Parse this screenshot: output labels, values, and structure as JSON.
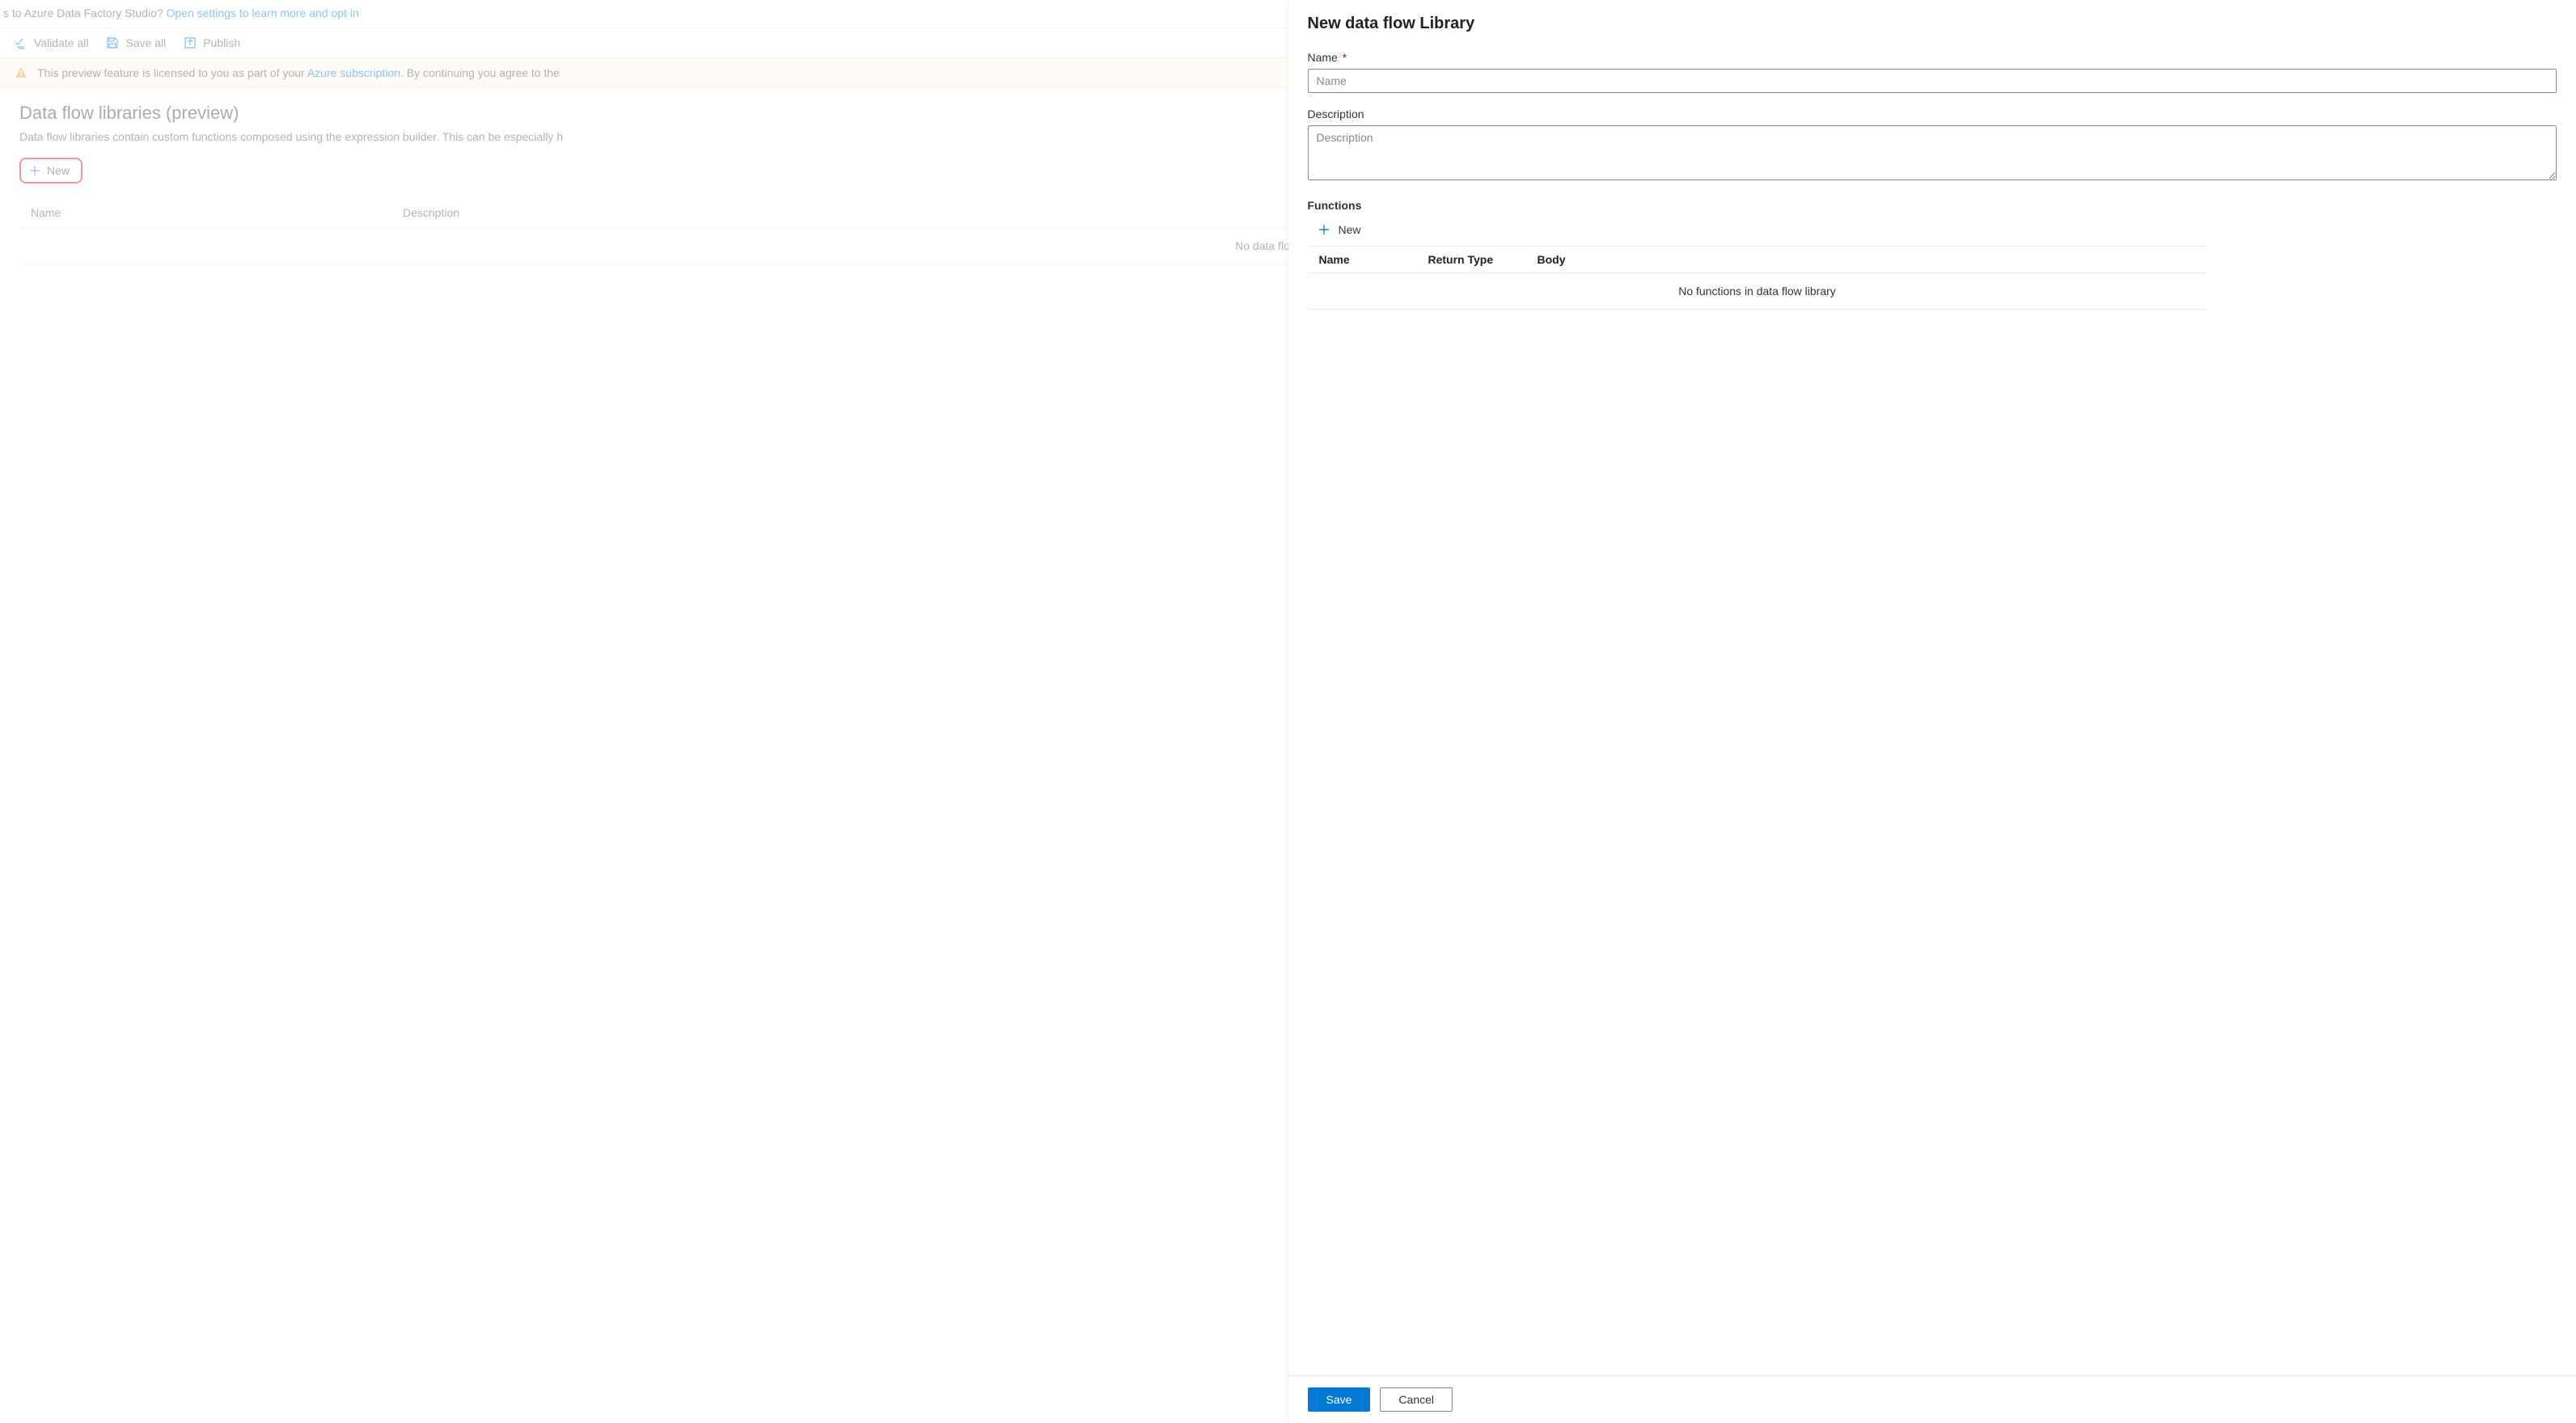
{
  "top_banner": {
    "prefix": "s to Azure Data Factory Studio? ",
    "link": "Open settings to learn more and opt in"
  },
  "toolbar": {
    "validate_all": "Validate all",
    "save_all": "Save all",
    "publish": "Publish"
  },
  "info_bar": {
    "text_before": "This preview feature is licensed to you as part of your ",
    "link": "Azure subscription.",
    "text_after": " By continuing you agree to the"
  },
  "page": {
    "title": "Data flow libraries (preview)",
    "subtitle": "Data flow libraries contain custom functions composed using the expression builder. This can be especially h",
    "new_button": "New",
    "table": {
      "col_name": "Name",
      "col_description": "Description",
      "empty": "No data flow libraries "
    }
  },
  "panel": {
    "title": "New data flow Library",
    "name_label": "Name",
    "name_required": "*",
    "name_placeholder": "Name",
    "description_label": "Description",
    "description_placeholder": "Description",
    "functions_label": "Functions",
    "functions_new": "New",
    "functions_table": {
      "col_name": "Name",
      "col_return_type": "Return Type",
      "col_body": "Body",
      "empty": "No functions in data flow library"
    },
    "save": "Save",
    "cancel": "Cancel"
  }
}
